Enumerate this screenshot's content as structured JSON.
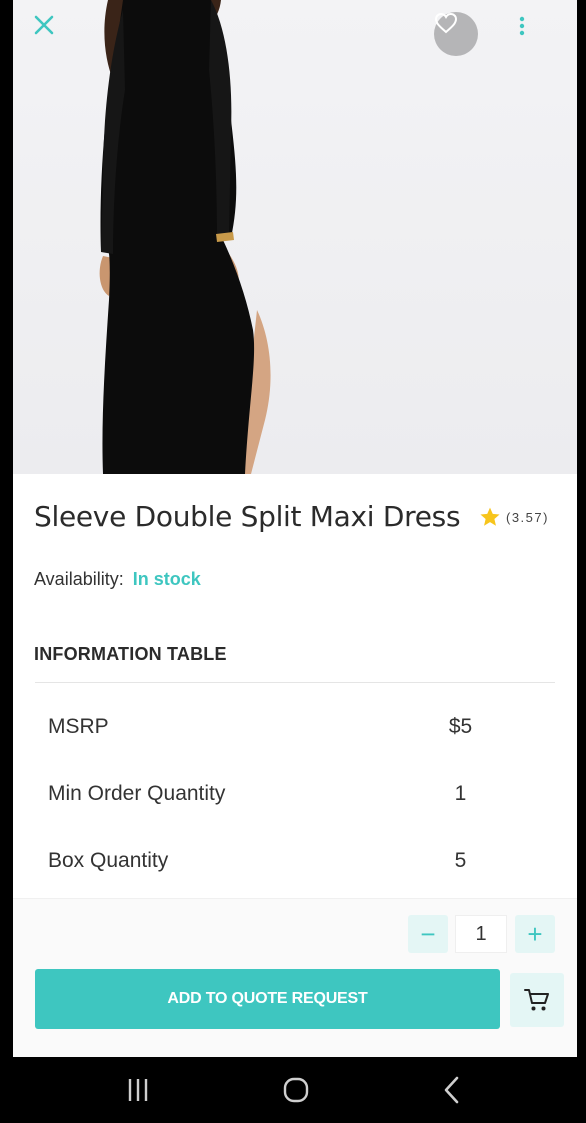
{
  "product": {
    "title": "Sleeve Double Split Maxi Dress",
    "rating": "(3.57)",
    "availability_label": "Availability:",
    "availability_value": "In stock"
  },
  "info_table": {
    "heading": "INFORMATION TABLE",
    "rows": [
      {
        "label": "MSRP",
        "value": "$5"
      },
      {
        "label": "Min Order Quantity",
        "value": "1"
      },
      {
        "label": "Box Quantity",
        "value": "5"
      }
    ]
  },
  "actions": {
    "quantity": "1",
    "minus_symbol": "−",
    "plus_symbol": "+",
    "add_button_label": "ADD TO QUOTE REQUEST"
  },
  "icons": {
    "close": "close-icon",
    "favorite": "heart-icon",
    "more": "more-vertical-icon",
    "rating": "star-icon",
    "cart": "cart-icon",
    "nav_recents": "recents-icon",
    "nav_home": "home-icon",
    "nav_back": "back-icon"
  },
  "colors": {
    "accent": "#3ec6c0",
    "accent_light": "#e4f6f5",
    "star": "#f7c51c"
  }
}
